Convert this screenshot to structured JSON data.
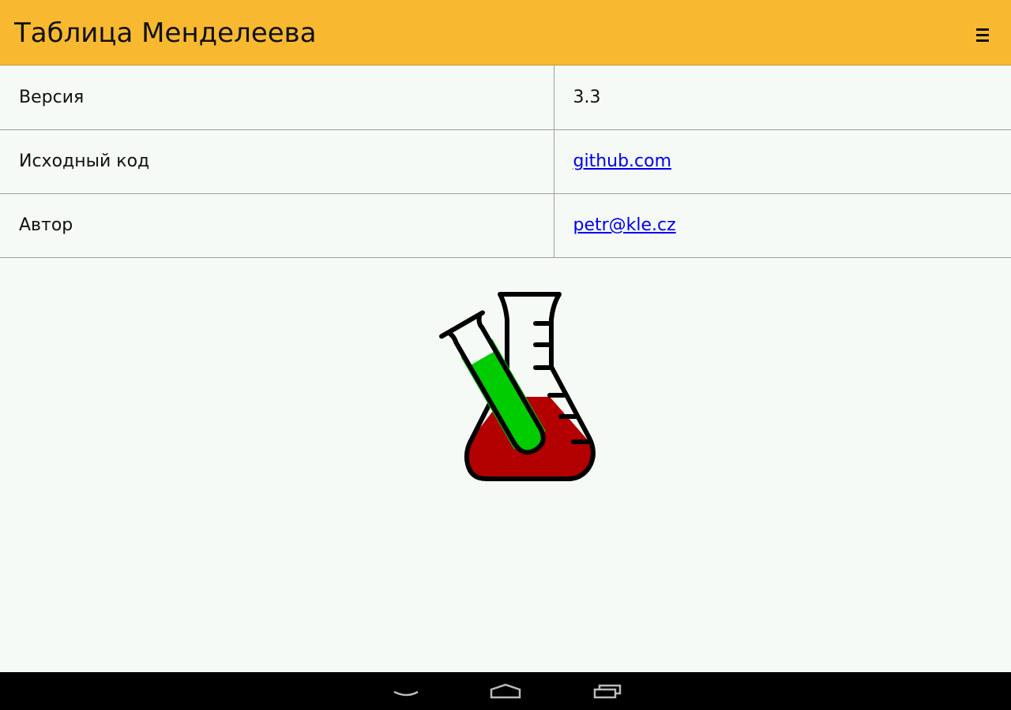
{
  "app": {
    "title": "Таблица Менделеева",
    "menu_icon": "hamburger-menu-icon",
    "header_color": "#f8b931"
  },
  "info": {
    "rows": [
      {
        "label": "Версия",
        "value": "3.3",
        "is_link": false
      },
      {
        "label": "Исходный код",
        "value": "github.com",
        "is_link": true
      },
      {
        "label": "Автор",
        "value": "petr@kle.cz",
        "is_link": true
      }
    ],
    "link_color": "#0000ee"
  },
  "logo": {
    "icon": "chemistry-flask-test-tube-icon",
    "colors": {
      "flask_liquid": "#b30000",
      "tube_liquid": "#00cc00",
      "outline": "#000000"
    }
  },
  "nav": {
    "back_icon": "back-icon",
    "home_icon": "home-icon",
    "recents_icon": "recent-apps-icon"
  }
}
